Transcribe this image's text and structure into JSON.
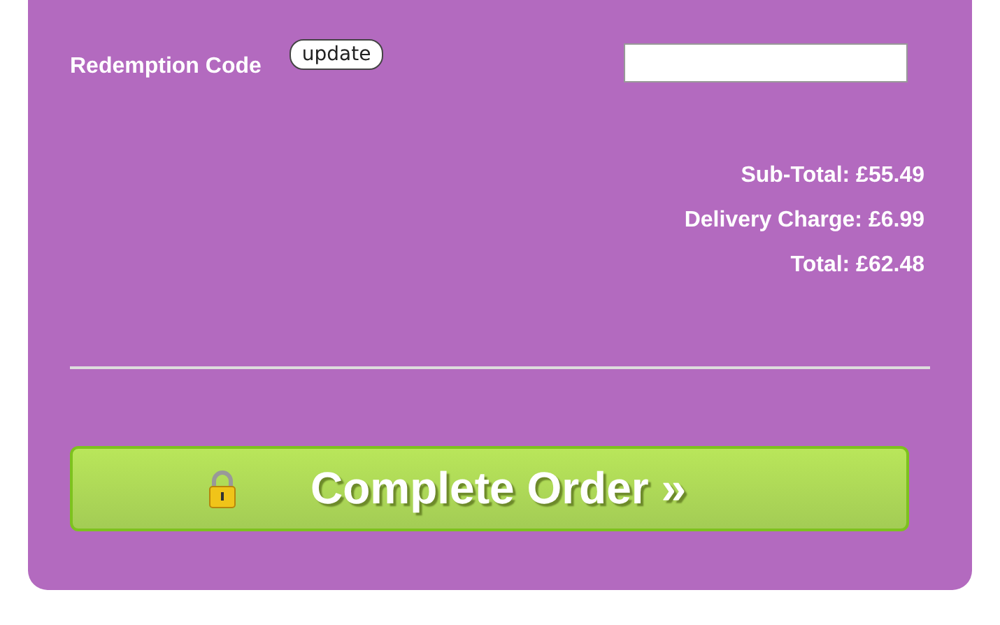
{
  "redemption": {
    "label": "Redemption Code",
    "button": "update"
  },
  "totals": [
    {
      "label": "Sub-Total:",
      "amount": "£55.49"
    },
    {
      "label": "Delivery Charge:",
      "amount": "£6.99"
    },
    {
      "label": "Total:",
      "amount": "£62.48"
    }
  ],
  "checkout": {
    "label": "Complete Order »"
  }
}
